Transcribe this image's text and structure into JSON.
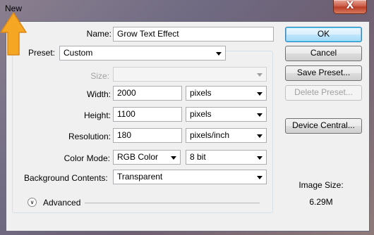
{
  "window": {
    "title": "New",
    "close_label": "X"
  },
  "form": {
    "name_label": "Name:",
    "name_value": "Grow Text Effect",
    "preset_label": "Preset:",
    "preset_value": "Custom",
    "size_label": "Size:",
    "size_value": "",
    "width_label": "Width:",
    "width_value": "2000",
    "width_unit": "pixels",
    "height_label": "Height:",
    "height_value": "1100",
    "height_unit": "pixels",
    "resolution_label": "Resolution:",
    "resolution_value": "180",
    "resolution_unit": "pixels/inch",
    "color_mode_label": "Color Mode:",
    "color_mode_value": "RGB Color",
    "bit_depth_value": "8 bit",
    "background_label": "Background Contents:",
    "background_value": "Transparent",
    "advanced_label": "Advanced"
  },
  "buttons": {
    "ok": "OK",
    "cancel": "Cancel",
    "save_preset": "Save Preset...",
    "delete_preset": "Delete Preset...",
    "device_central": "Device Central..."
  },
  "image_size": {
    "label": "Image Size:",
    "value": "6.29M"
  },
  "colors": {
    "arrow": "#f5a623",
    "close": "#c75540",
    "default_button": "#3c7fb1"
  }
}
